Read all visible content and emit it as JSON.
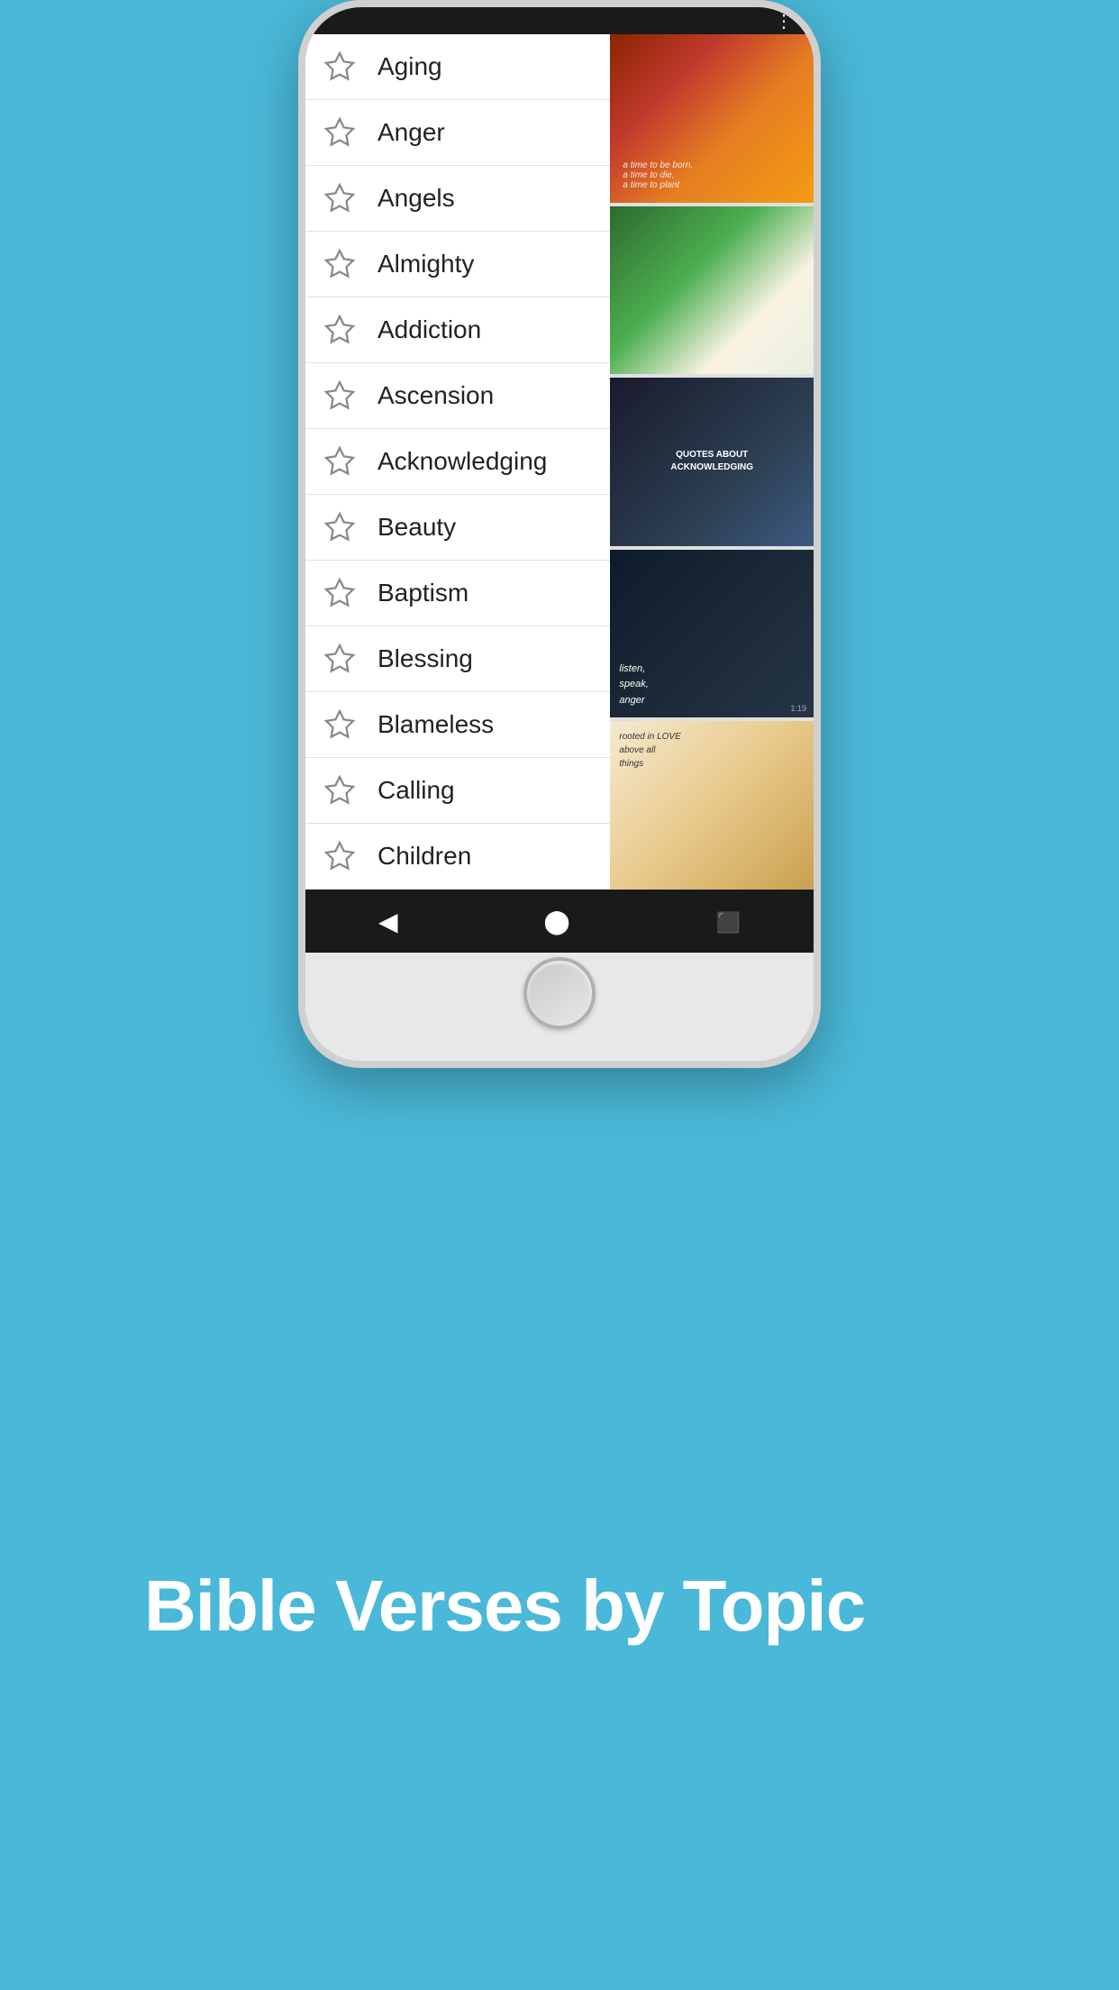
{
  "page": {
    "title": "Bible Verses by Topic",
    "background_color": "#4ab8d8"
  },
  "phone": {
    "top_bar": {
      "menu_icon": "⋮"
    },
    "list_items": [
      {
        "id": 1,
        "label": "Aging",
        "starred": false
      },
      {
        "id": 2,
        "label": "Anger",
        "starred": false
      },
      {
        "id": 3,
        "label": "Angels",
        "starred": false
      },
      {
        "id": 4,
        "label": "Almighty",
        "starred": false
      },
      {
        "id": 5,
        "label": "Addiction",
        "starred": false
      },
      {
        "id": 6,
        "label": "Ascension",
        "starred": false
      },
      {
        "id": 7,
        "label": "Acknowledging",
        "starred": false
      },
      {
        "id": 8,
        "label": "Beauty",
        "starred": false
      },
      {
        "id": 9,
        "label": "Baptism",
        "starred": false
      },
      {
        "id": 10,
        "label": "Blessing",
        "starred": false
      },
      {
        "id": 11,
        "label": "Blameless",
        "starred": false
      },
      {
        "id": 12,
        "label": "Calling",
        "starred": false
      },
      {
        "id": 13,
        "label": "Children",
        "starred": false
      }
    ],
    "nav_buttons": {
      "back": "◀",
      "home": "⬤",
      "recents": "⬛"
    }
  }
}
